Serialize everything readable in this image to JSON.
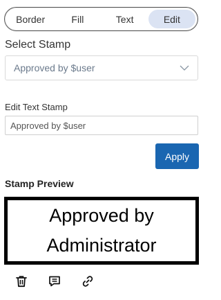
{
  "tabs": [
    {
      "label": "Border",
      "active": false
    },
    {
      "label": "Fill",
      "active": false
    },
    {
      "label": "Text",
      "active": false
    },
    {
      "label": "Edit",
      "active": true
    }
  ],
  "select_stamp": {
    "label": "Select Stamp",
    "value": "Approved by $user",
    "icon": "chevron-down-icon"
  },
  "edit_text": {
    "label": "Edit Text Stamp",
    "value": "Approved by $user"
  },
  "apply_button": {
    "label": "Apply",
    "color": "#1a66b1"
  },
  "preview": {
    "label": "Stamp Preview",
    "line1": "Approved by",
    "line2": "Administrator"
  },
  "actions": [
    {
      "icon": "trash-icon"
    },
    {
      "icon": "comment-icon"
    },
    {
      "icon": "link-icon"
    }
  ]
}
